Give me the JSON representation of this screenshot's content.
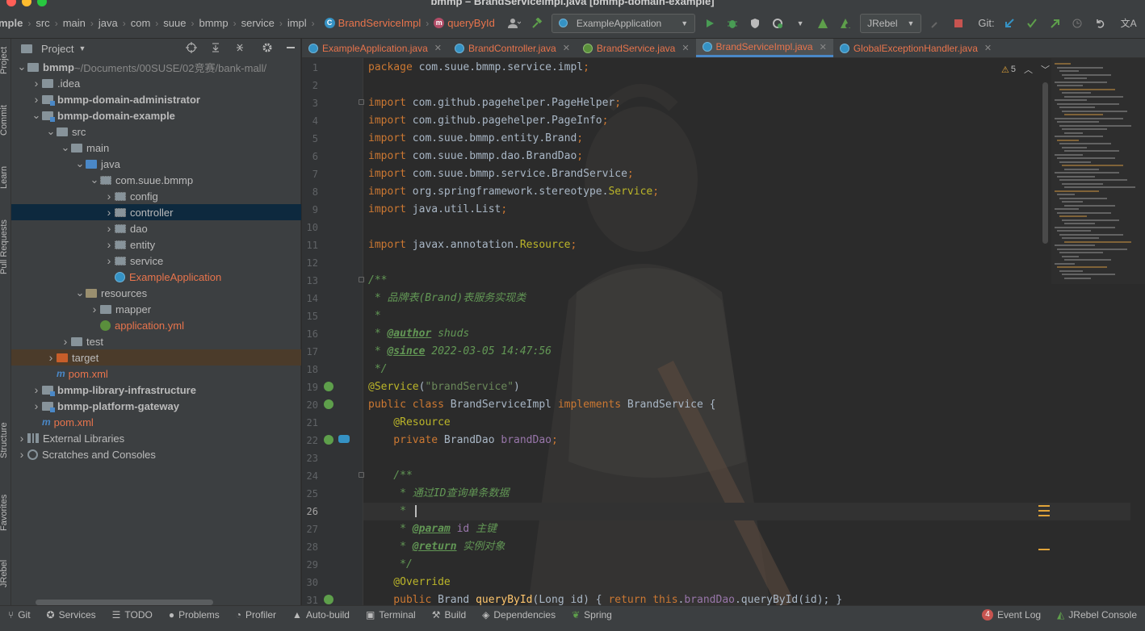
{
  "window": {
    "title": "bmmp – BrandServiceImpl.java [bmmp-domain-example]"
  },
  "breadcrumb": [
    "mple",
    "src",
    "main",
    "java",
    "com",
    "suue",
    "bmmp",
    "service",
    "impl"
  ],
  "breadcrumb_class": "BrandServiceImpl",
  "breadcrumb_method": "queryById",
  "toolbar": {
    "run_config": "ExampleApplication",
    "jrebel": "JRebel",
    "git_label": "Git:"
  },
  "project_panel": {
    "title": "Project",
    "tree": [
      {
        "label": "bmmp",
        "extra": " ~/Documents/00SUSE/02竞赛/bank-mall/",
        "depth": 0,
        "arrow": "down",
        "icon": "folder",
        "bold": true
      },
      {
        "label": ".idea",
        "depth": 1,
        "arrow": "right",
        "icon": "folder"
      },
      {
        "label": "bmmp-domain-administrator",
        "depth": 1,
        "arrow": "right",
        "icon": "module",
        "bold": true
      },
      {
        "label": "bmmp-domain-example",
        "depth": 1,
        "arrow": "down",
        "icon": "module",
        "bold": true
      },
      {
        "label": "src",
        "depth": 2,
        "arrow": "down",
        "icon": "folder"
      },
      {
        "label": "main",
        "depth": 3,
        "arrow": "down",
        "icon": "folder"
      },
      {
        "label": "java",
        "depth": 4,
        "arrow": "down",
        "icon": "folder-blue"
      },
      {
        "label": "com.suue.bmmp",
        "depth": 5,
        "arrow": "down",
        "icon": "package"
      },
      {
        "label": "config",
        "depth": 6,
        "arrow": "right",
        "icon": "package"
      },
      {
        "label": "controller",
        "depth": 6,
        "arrow": "right",
        "icon": "package",
        "selected": true
      },
      {
        "label": "dao",
        "depth": 6,
        "arrow": "right",
        "icon": "package"
      },
      {
        "label": "entity",
        "depth": 6,
        "arrow": "right",
        "icon": "package"
      },
      {
        "label": "service",
        "depth": 6,
        "arrow": "right",
        "icon": "package"
      },
      {
        "label": "ExampleApplication",
        "depth": 6,
        "arrow": "none",
        "icon": "java-class",
        "red": true
      },
      {
        "label": "resources",
        "depth": 4,
        "arrow": "down",
        "icon": "resources"
      },
      {
        "label": "mapper",
        "depth": 5,
        "arrow": "right",
        "icon": "folder"
      },
      {
        "label": "application.yml",
        "depth": 5,
        "arrow": "none",
        "icon": "yml",
        "red": true
      },
      {
        "label": "test",
        "depth": 3,
        "arrow": "right",
        "icon": "folder"
      },
      {
        "label": "target",
        "depth": 2,
        "arrow": "right",
        "icon": "folder-orange",
        "highlight": true
      },
      {
        "label": "pom.xml",
        "depth": 2,
        "arrow": "none",
        "icon": "maven",
        "red": true
      },
      {
        "label": "bmmp-library-infrastructure",
        "depth": 1,
        "arrow": "right",
        "icon": "module",
        "bold": true
      },
      {
        "label": "bmmp-platform-gateway",
        "depth": 1,
        "arrow": "right",
        "icon": "module",
        "bold": true
      },
      {
        "label": "pom.xml",
        "depth": 1,
        "arrow": "none",
        "icon": "maven",
        "red": true
      },
      {
        "label": "External Libraries",
        "depth": 0,
        "arrow": "right",
        "icon": "library"
      },
      {
        "label": "Scratches and Consoles",
        "depth": 0,
        "arrow": "right",
        "icon": "scratch"
      }
    ]
  },
  "left_strip": [
    "Project",
    "Commit",
    "Learn",
    "Pull Requests",
    "Structure",
    "Favorites",
    "JRebel"
  ],
  "tabs": [
    {
      "label": "ExampleApplication.java",
      "icon": "class"
    },
    {
      "label": "BrandController.java",
      "icon": "class"
    },
    {
      "label": "BrandService.java",
      "icon": "interface"
    },
    {
      "label": "BrandServiceImpl.java",
      "icon": "class",
      "active": true
    },
    {
      "label": "GlobalExceptionHandler.java",
      "icon": "class"
    }
  ],
  "editor": {
    "warnings": "5",
    "code_lines": [
      [
        [
          "kw",
          "package "
        ],
        [
          "",
          "com.suue.bmmp.service.impl"
        ],
        [
          "kw",
          ";"
        ]
      ],
      [],
      [
        [
          "kw",
          "import "
        ],
        [
          "",
          "com.github.pagehelper.PageHelper"
        ],
        [
          "kw",
          ";"
        ]
      ],
      [
        [
          "kw",
          "import "
        ],
        [
          "",
          "com.github.pagehelper.PageInfo"
        ],
        [
          "kw",
          ";"
        ]
      ],
      [
        [
          "kw",
          "import "
        ],
        [
          "",
          "com.suue.bmmp.entity.Brand"
        ],
        [
          "kw",
          ";"
        ]
      ],
      [
        [
          "kw",
          "import "
        ],
        [
          "",
          "com.suue.bmmp.dao.BrandDao"
        ],
        [
          "kw",
          ";"
        ]
      ],
      [
        [
          "kw",
          "import "
        ],
        [
          "",
          "com.suue.bmmp.service.BrandService"
        ],
        [
          "kw",
          ";"
        ]
      ],
      [
        [
          "kw",
          "import "
        ],
        [
          "",
          "org.springframework.stereotype."
        ],
        [
          "ann",
          "Service"
        ],
        [
          "kw",
          ";"
        ]
      ],
      [
        [
          "kw",
          "import "
        ],
        [
          "",
          "java.util.List"
        ],
        [
          "kw",
          ";"
        ]
      ],
      [],
      [
        [
          "kw",
          "import "
        ],
        [
          "",
          "javax.annotation."
        ],
        [
          "ann",
          "Resource"
        ],
        [
          "kw",
          ";"
        ]
      ],
      [],
      [
        [
          "cmt",
          "/**"
        ]
      ],
      [
        [
          "cmt",
          " * 品牌表(Brand)表服务实现类"
        ]
      ],
      [
        [
          "cmt",
          " *"
        ]
      ],
      [
        [
          "cmt",
          " * "
        ],
        [
          "tag",
          "@author"
        ],
        [
          "cmt",
          " shuds"
        ]
      ],
      [
        [
          "cmt",
          " * "
        ],
        [
          "tag",
          "@since"
        ],
        [
          "cmt",
          " 2022-03-05 14:47:56"
        ]
      ],
      [
        [
          "cmt",
          " */"
        ]
      ],
      [
        [
          "ann",
          "@Service"
        ],
        [
          "",
          "("
        ],
        [
          "str",
          "\"brandService\""
        ],
        [
          "",
          ")"
        ]
      ],
      [
        [
          "kw",
          "public class "
        ],
        [
          "",
          "BrandServiceImpl "
        ],
        [
          "kw",
          "implements "
        ],
        [
          "",
          "BrandService {"
        ]
      ],
      [
        [
          "ann",
          "    @Resource"
        ]
      ],
      [
        [
          "kw",
          "    private "
        ],
        [
          "",
          "BrandDao "
        ],
        [
          "fld",
          "brandDao"
        ],
        [
          "kw",
          ";"
        ]
      ],
      [],
      [
        [
          "cmt",
          "    /**"
        ]
      ],
      [
        [
          "cmt",
          "     * 通过ID查询单条数据"
        ]
      ],
      [
        [
          "cmt",
          "     *"
        ]
      ],
      [
        [
          "cmt",
          "     * "
        ],
        [
          "tag",
          "@param"
        ],
        [
          "cmt",
          " "
        ],
        [
          "ghost",
          "id"
        ],
        [
          "cmt",
          " 主键"
        ]
      ],
      [
        [
          "cmt",
          "     * "
        ],
        [
          "tag",
          "@return"
        ],
        [
          "cmt",
          " 实例对象"
        ]
      ],
      [
        [
          "cmt",
          "     */"
        ]
      ],
      [
        [
          "ann",
          "    @Override"
        ]
      ],
      [
        [
          "kw",
          "    public "
        ],
        [
          "",
          "Brand "
        ],
        [
          "mth",
          "queryById"
        ],
        [
          "",
          "(Long id) { "
        ],
        [
          "kw",
          "return this"
        ],
        [
          "",
          "."
        ],
        [
          "fld",
          "brandDao"
        ],
        [
          "",
          ".queryById(id); }"
        ]
      ]
    ]
  },
  "statusbar": {
    "items": [
      "Git",
      "Services",
      "TODO",
      "Problems",
      "Profiler",
      "Auto-build",
      "Terminal",
      "Build",
      "Dependencies",
      "Spring"
    ],
    "right": [
      {
        "label": "Event Log",
        "badge": "4"
      },
      {
        "label": "JRebel Console"
      }
    ]
  },
  "colors": {
    "keyword": "#cc7832",
    "annotation": "#bbb529",
    "string": "#6a8759",
    "comment": "#629755",
    "field": "#9876aa",
    "method": "#ffc66d",
    "modified_file": "#e8744c",
    "selection": "#0d293e"
  }
}
